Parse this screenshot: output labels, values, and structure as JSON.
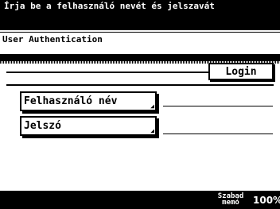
{
  "message": "Írja be a felhasználó nevét és jelszavát",
  "screen_title": "User Authentication",
  "login_button": "Login",
  "fields": [
    {
      "label": "Felhasználó név",
      "value": ""
    },
    {
      "label": "Jelszó",
      "value": ""
    }
  ],
  "status": {
    "memory_label": "Szabad memó",
    "memory_value": "100%"
  },
  "colors": {
    "background": "#ffffff",
    "bars": "#000000"
  }
}
